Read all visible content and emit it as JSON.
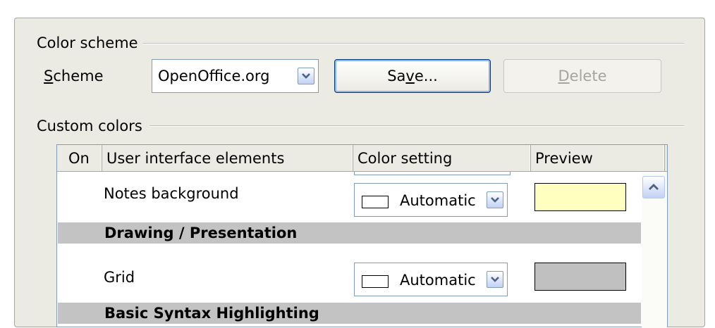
{
  "color_scheme": {
    "group_label": "Color scheme",
    "scheme_label_mnemonic": "S",
    "scheme_label_rest": "cheme",
    "scheme_value": "OpenOffice.org",
    "save_pre": "Sa",
    "save_mnemonic": "v",
    "save_post": "e...",
    "delete_mnemonic": "D",
    "delete_rest": "elete"
  },
  "custom_colors": {
    "group_label": "Custom colors",
    "columns": [
      "On",
      "User interface elements",
      "Color setting",
      "Preview"
    ],
    "rows": [
      {
        "kind": "item",
        "label": "Notes background",
        "color_setting": "Automatic",
        "preview_color": "#ffffc0"
      },
      {
        "kind": "section",
        "label": "Drawing / Presentation"
      },
      {
        "kind": "item",
        "label": "Grid",
        "color_setting": "Automatic",
        "preview_color": "#c0c0c0"
      },
      {
        "kind": "section",
        "label": "Basic Syntax Highlighting"
      }
    ]
  },
  "colors": {
    "dialog_bg": "#ecebe3",
    "section_bg": "#c3c3c3",
    "button_border": "#003c74",
    "field_border": "#7f9db9"
  }
}
